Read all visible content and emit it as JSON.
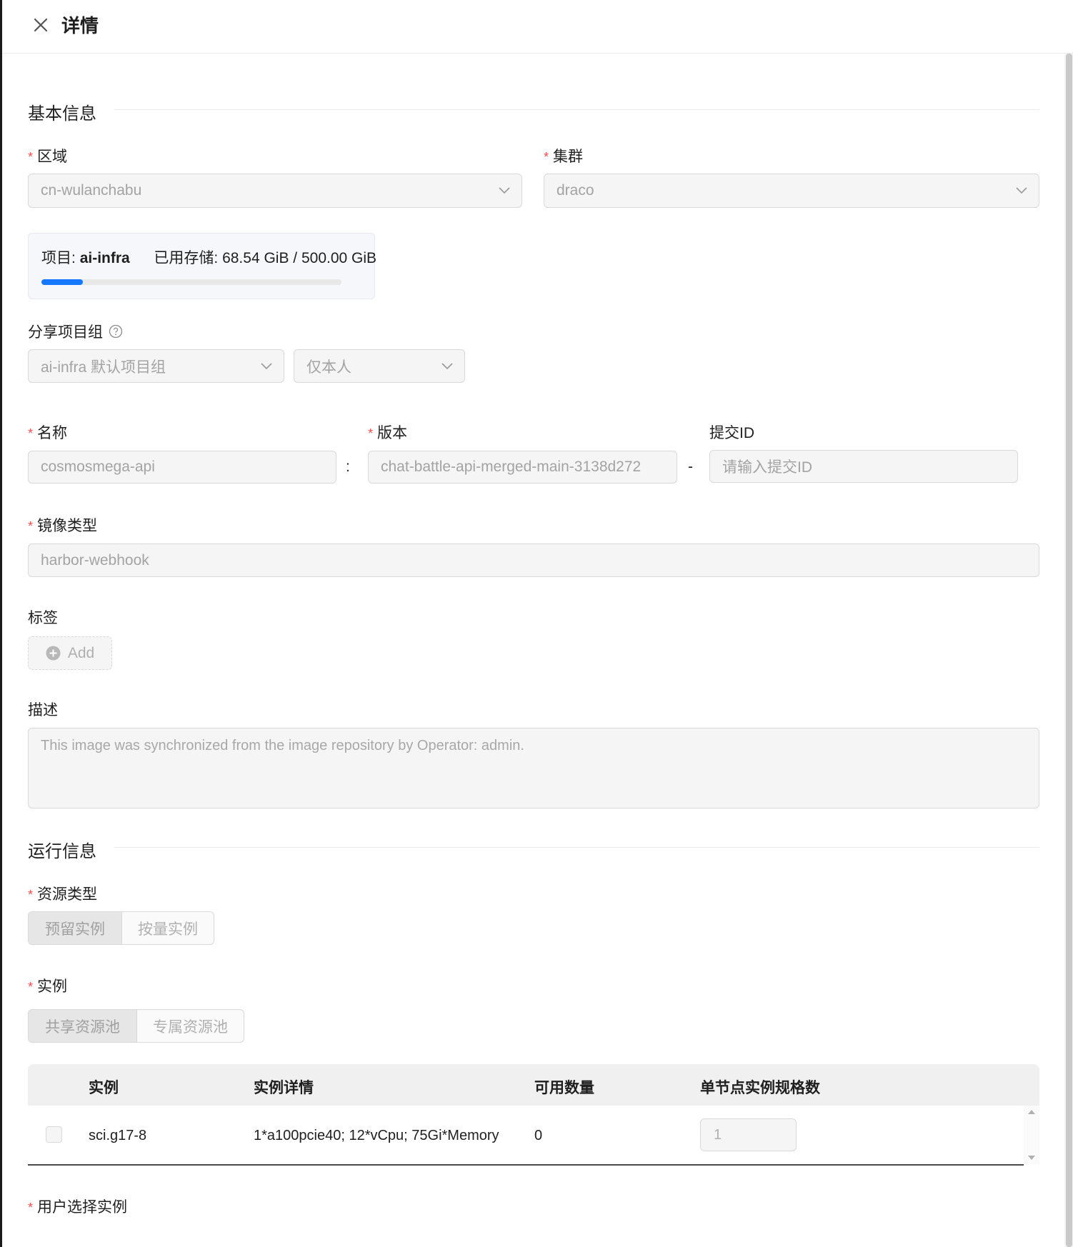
{
  "header": {
    "title": "详情"
  },
  "basic_section": {
    "title": "基本信息"
  },
  "region": {
    "label": "区域",
    "value": "cn-wulanchabu"
  },
  "cluster": {
    "label": "集群",
    "value": "draco"
  },
  "storage": {
    "project_prefix": "项目:",
    "project": "ai-infra",
    "used_label": "已用存储:",
    "used": "68.54 GiB / 500.00 GiB",
    "fraction": 0.137
  },
  "share_group": {
    "label": "分享项目组",
    "group_value": "ai-infra 默认项目组",
    "scope_value": "仅本人"
  },
  "name": {
    "label": "名称",
    "value": "cosmosmega-api"
  },
  "sep_colon": ":",
  "version": {
    "label": "版本",
    "value": "chat-battle-api-merged-main-3138d272"
  },
  "sep_dash": "-",
  "commit": {
    "label": "提交ID",
    "placeholder": "请输入提交ID"
  },
  "image_type": {
    "label": "镜像类型",
    "value": "harbor-webhook"
  },
  "tags": {
    "label": "标签",
    "add_label": "Add"
  },
  "description": {
    "label": "描述",
    "placeholder": "This image was synchronized from the image repository by Operator: admin."
  },
  "run_section": {
    "title": "运行信息"
  },
  "resource_type": {
    "label": "资源类型",
    "options": [
      "预留实例",
      "按量实例"
    ]
  },
  "instance": {
    "label": "实例",
    "options": [
      "共享资源池",
      "专属资源池"
    ]
  },
  "table": {
    "headers": [
      "实例",
      "实例详情",
      "可用数量",
      "单节点实例规格数"
    ],
    "rows": [
      {
        "name": "sci.g17-8",
        "detail": "1*a100pcie40; 12*vCpu; 75Gi*Memory",
        "available": "0",
        "spec_count": "1"
      }
    ]
  },
  "user_select": {
    "label": "用户选择实例"
  },
  "colors": {
    "required": "#ff4d4f",
    "accent": "#1677ff"
  }
}
